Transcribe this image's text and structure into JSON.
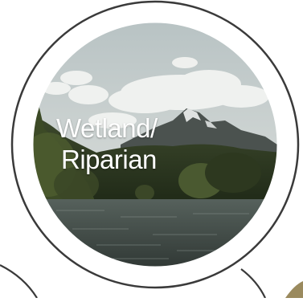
{
  "tile": {
    "label_line1": "Wetland/",
    "label_line2": "Riparian",
    "image_subject": "mountain-lake-photo",
    "ring_color": "#3a3a3a"
  },
  "colors": {
    "sky": "#c7cfcf",
    "cloud": "#f3f4f2",
    "mountain": "#4a4f4c",
    "snow": "#d9dcdb",
    "forest": "#2f3a22",
    "water": "#3b4540",
    "label": "#ffffff"
  }
}
